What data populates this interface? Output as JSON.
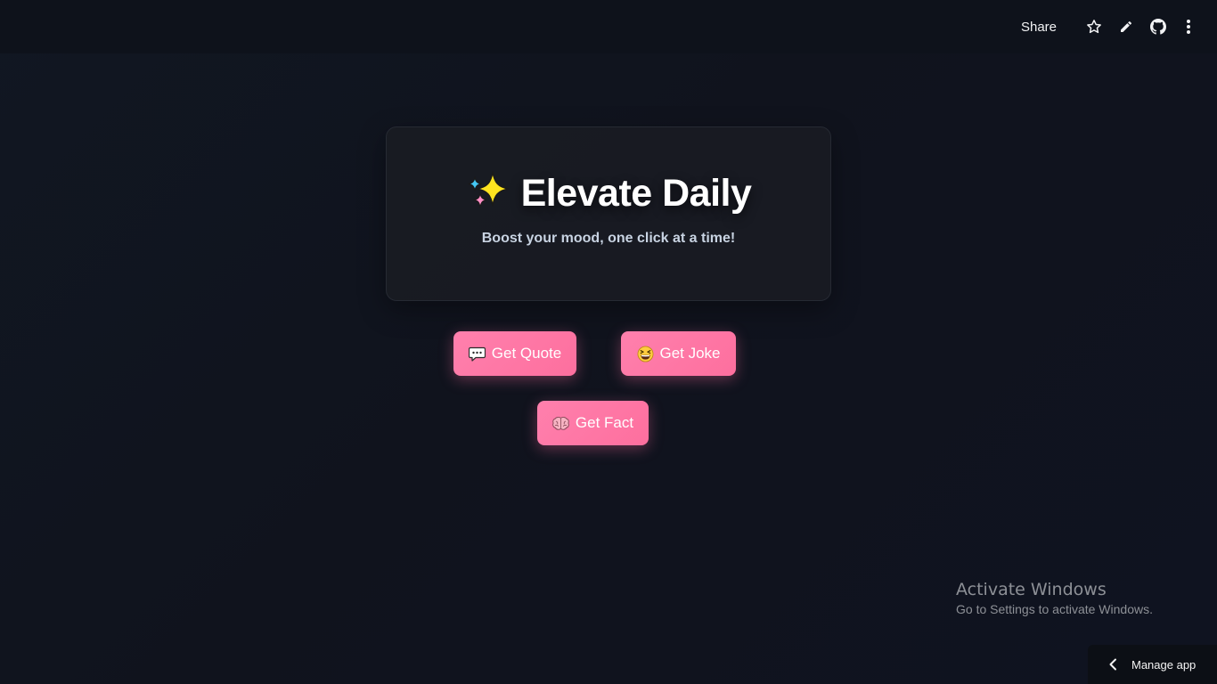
{
  "toolbar": {
    "share_label": "Share",
    "icons": [
      "star-icon",
      "pencil-icon",
      "github-icon",
      "more-vertical-icon"
    ]
  },
  "hero": {
    "title": "Elevate Daily",
    "title_icon": "sparkles-icon",
    "subtitle": "Boost your mood, one click at a time!"
  },
  "actions": {
    "quote": {
      "label": "Get Quote",
      "icon": "speech-balloon-icon"
    },
    "joke": {
      "label": "Get Joke",
      "icon": "grinning-squinting-face-icon"
    },
    "fact": {
      "label": "Get Fact",
      "icon": "brain-icon"
    }
  },
  "watermark": {
    "title": "Activate Windows",
    "subtitle": "Go to Settings to activate Windows."
  },
  "manage_app": {
    "label": "Manage app"
  },
  "colors": {
    "background": "#10131d",
    "button_accent": "#fd6f9e",
    "card_border": "#262a33",
    "subtitle_text": "#c8d3e2"
  }
}
